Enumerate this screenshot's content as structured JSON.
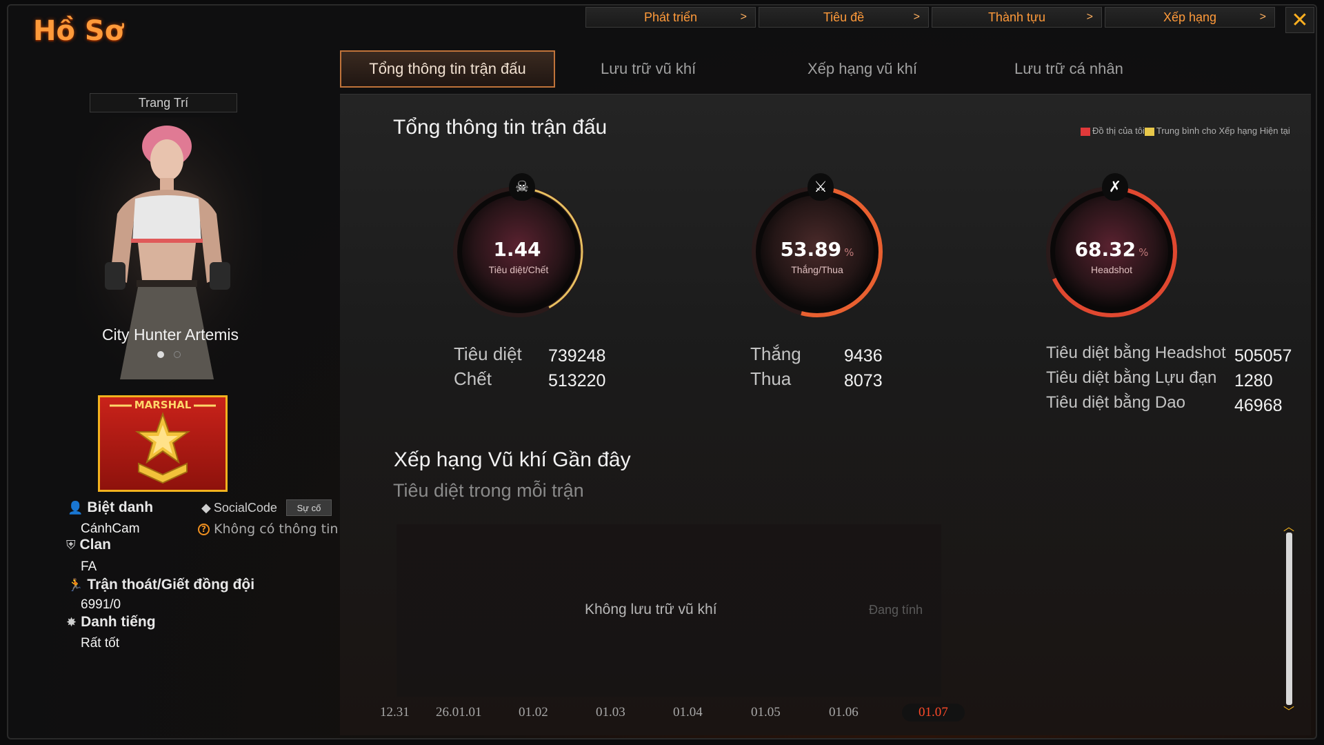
{
  "window": {
    "title": "Hồ Sơ",
    "close_label": "✕"
  },
  "top_nav": [
    {
      "label": "Phát triển"
    },
    {
      "label": "Tiêu đề"
    },
    {
      "label": "Thành tựu"
    },
    {
      "label": "Xếp hạng"
    }
  ],
  "tabs": [
    {
      "label": "Tổng thông tin trận đấu",
      "active": true
    },
    {
      "label": "Lưu trữ vũ khí"
    },
    {
      "label": "Xếp hạng vũ khí"
    },
    {
      "label": "Lưu trữ cá nhân"
    }
  ],
  "left": {
    "decor_button": "Trang Trí",
    "character_name": "City Hunter Artemis",
    "rank_label": "MARSHAL",
    "nickname_label": "Biệt danh",
    "nickname_value": "CánhCam",
    "social_code_label": "SocialCode",
    "social_code_button": "Sự cố",
    "social_code_value": "Không có thông tin",
    "clan_label": "Clan",
    "clan_value": "FA",
    "escape_label": "Trận thoát/Giết đồng đội",
    "escape_value": "6991/0",
    "reputation_label": "Danh tiếng",
    "reputation_value": "Rất tốt"
  },
  "main": {
    "summary_title": "Tổng thông tin trận đấu",
    "legend_mine": "Đồ thị của tôi",
    "legend_avg": "Trung bình cho Xếp hạng Hiện tại",
    "legend_colors": {
      "mine": "#e0393a",
      "avg": "#e8c84a"
    },
    "gauges": [
      {
        "value": "1.44",
        "unit": "",
        "label": "Tiêu diệt/Chết",
        "icon": "skull-icon",
        "fill": 0.42
      },
      {
        "value": "53.89",
        "unit": "%",
        "label": "Thắng/Thua",
        "icon": "crossed-guns-icon",
        "fill": 0.54
      },
      {
        "value": "68.32",
        "unit": "%",
        "label": "Headshot",
        "icon": "crossed-rifle-icon",
        "fill": 0.68
      }
    ],
    "stats": {
      "kills_label": "Tiêu diệt",
      "kills_value": "739248",
      "deaths_label": "Chết",
      "deaths_value": "513220",
      "wins_label": "Thắng",
      "wins_value": "9436",
      "losses_label": "Thua",
      "losses_value": "8073",
      "hs_label": "Tiêu diệt bằng Headshot",
      "hs_value": "505057",
      "grenade_label": "Tiêu diệt bằng Lựu đạn",
      "grenade_value": "1280",
      "knife_label": "Tiêu diệt bằng Dao",
      "knife_value": "46968"
    },
    "weapon_title": "Xếp hạng Vũ khí Gần đây",
    "weapon_subtitle": "Tiêu diệt trong mỗi trận",
    "no_weapon": "Không lưu trữ vũ khí",
    "calculating": "Đang tính",
    "x_labels": [
      "12.31",
      "26.01.01",
      "01.02",
      "01.03",
      "01.04",
      "01.05",
      "01.06",
      "01.07"
    ],
    "selected_date": "01.07"
  }
}
